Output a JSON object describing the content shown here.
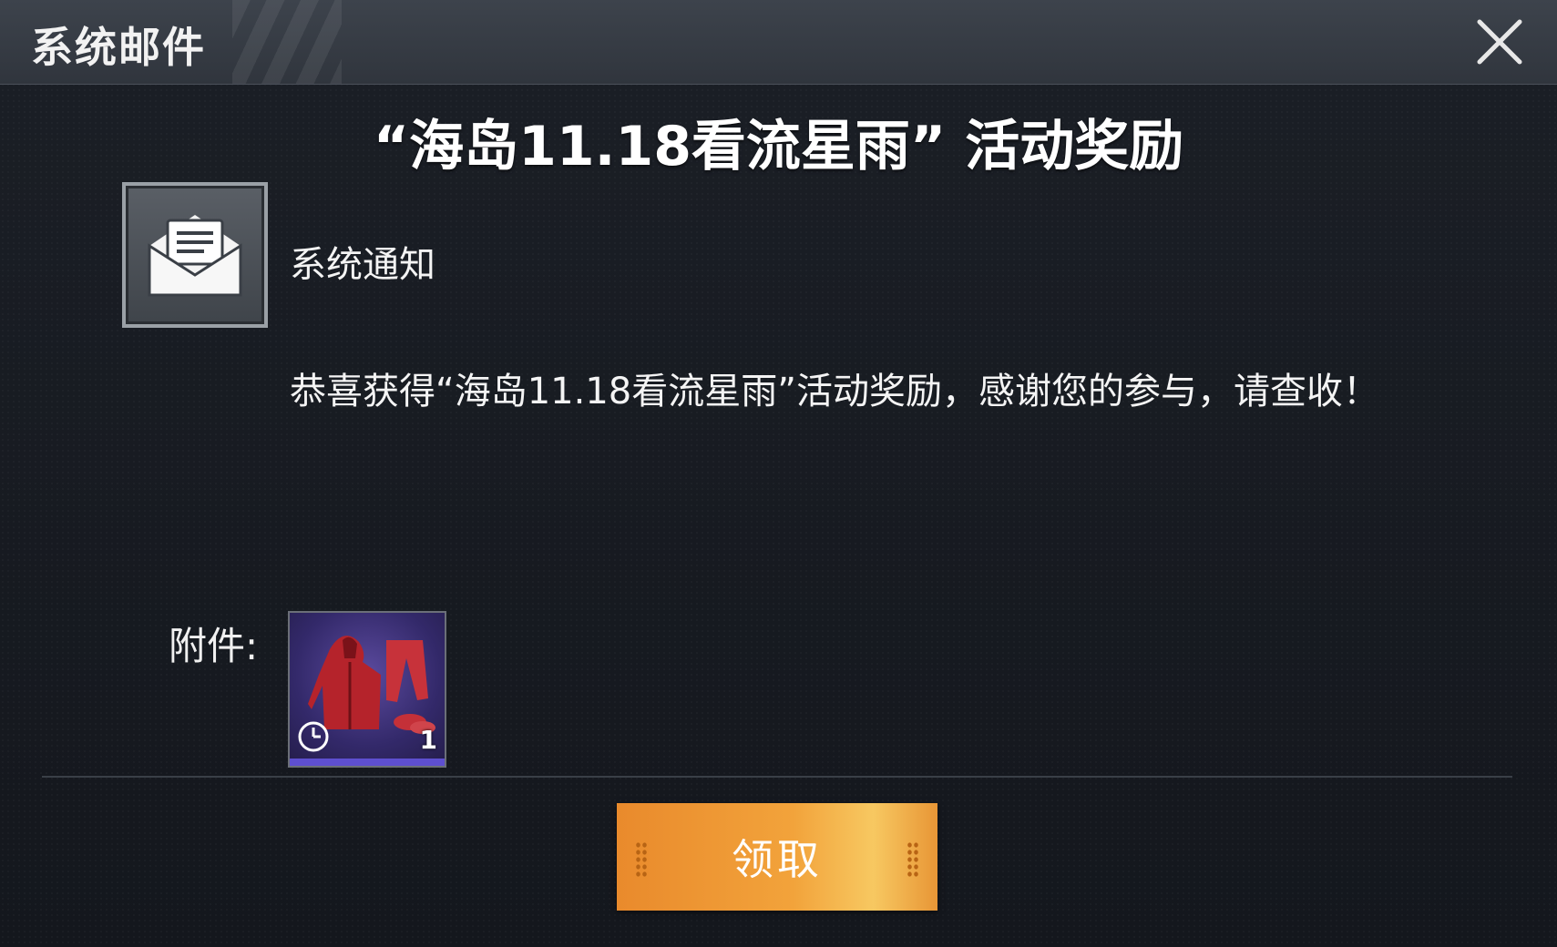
{
  "header": {
    "title": "系统邮件",
    "close_icon": "close-icon"
  },
  "mail": {
    "title": "“海岛11.18看流星雨” 活动奖励",
    "sender": {
      "name": "系统通知",
      "icon": "envelope-icon"
    },
    "body": "恭喜获得“海岛11.18看流星雨”活动奖励，感谢您的参与，请查收！"
  },
  "attachments": {
    "label": "附件:",
    "items": [
      {
        "icon": "red-outfit-icon",
        "count": "1",
        "timed": true,
        "quality_color": "#5e4fd0"
      }
    ]
  },
  "actions": {
    "claim_label": "领取"
  },
  "colors": {
    "header_bg": "#353a42",
    "claim_button": "#f2a33b",
    "background": "#16191f"
  }
}
